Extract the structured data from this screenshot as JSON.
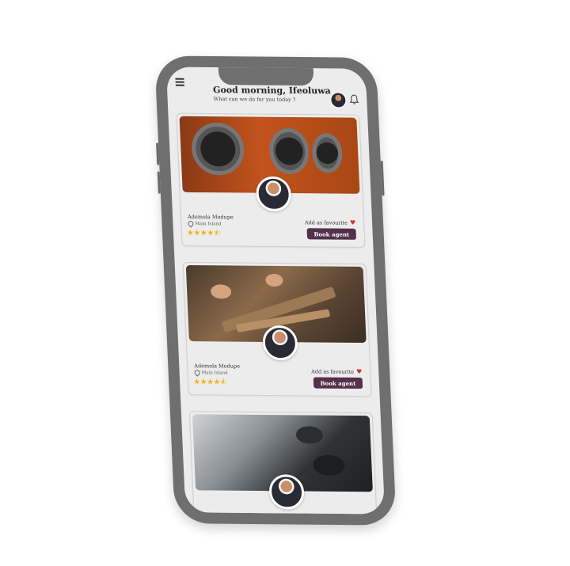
{
  "header": {
    "greeting": "Good morning, Ifeoluwa",
    "subtitle": "What can we do for you today ?"
  },
  "icons": {
    "menu": "menu-icon",
    "notification": "bell-icon",
    "location": "pin-icon",
    "favourite": "heart-icon",
    "rating": "star-icon"
  },
  "colors": {
    "accent": "#54304a",
    "heart": "#d63030",
    "star": "#f2b21b",
    "screen_bg": "#ececec",
    "phone_frame": "#6f6f6f"
  },
  "cards": [
    {
      "name": "Ademola Modupe",
      "location": "Main Island",
      "rating": 4.5,
      "stars": "★★★★⯪",
      "favourite_label": "Add as favourite",
      "heart": "♥",
      "button_label": "Book agent"
    },
    {
      "name": "Ademola Modupe",
      "location": "Main Island",
      "rating": 4.5,
      "stars": "★★★★⯪",
      "favourite_label": "Add as favourite",
      "heart": "♥",
      "button_label": "Book agent"
    }
  ]
}
